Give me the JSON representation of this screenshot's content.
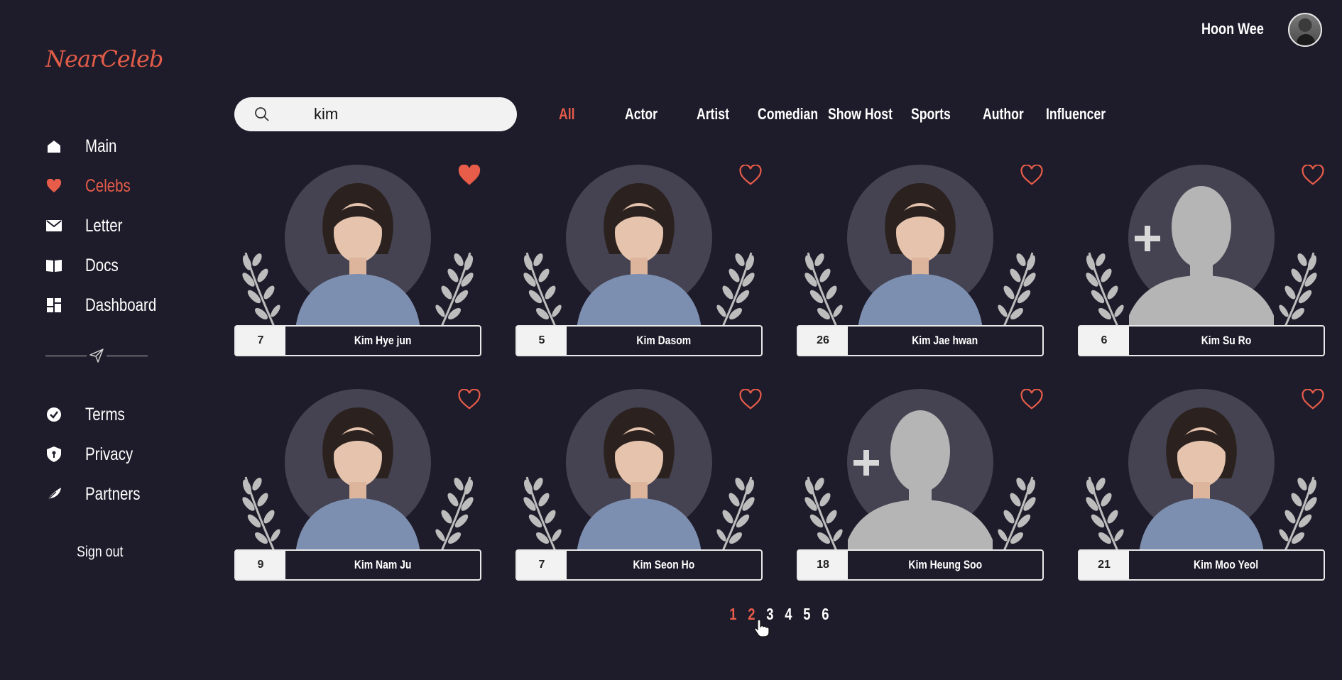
{
  "app": {
    "logo": "NearCeleb"
  },
  "header": {
    "user_name": "Hoon Wee"
  },
  "sidebar": {
    "items": [
      {
        "label": "Main",
        "icon": "home-icon"
      },
      {
        "label": "Celebs",
        "icon": "heart-icon",
        "active": true
      },
      {
        "label": "Letter",
        "icon": "mail-icon"
      },
      {
        "label": "Docs",
        "icon": "book-icon"
      },
      {
        "label": "Dashboard",
        "icon": "dashboard-icon"
      }
    ],
    "secondary_items": [
      {
        "label": "Terms",
        "icon": "check-circle-icon"
      },
      {
        "label": "Privacy",
        "icon": "shield-icon"
      },
      {
        "label": "Partners",
        "icon": "feather-icon"
      }
    ],
    "sign_out": "Sign out"
  },
  "search": {
    "value": "kim"
  },
  "tabs": [
    "All",
    "Actor",
    "Artist",
    "Comedian",
    "Show Host",
    "Sports",
    "Author",
    "Influencer"
  ],
  "active_tab": "All",
  "celebs": [
    {
      "count": "7",
      "name": "Kim Hye jun",
      "liked": true,
      "has_photo": true
    },
    {
      "count": "5",
      "name": "Kim Dasom",
      "liked": false,
      "has_photo": true
    },
    {
      "count": "26",
      "name": "Kim Jae hwan",
      "liked": false,
      "has_photo": true
    },
    {
      "count": "6",
      "name": "Kim Su Ro",
      "liked": false,
      "has_photo": false
    },
    {
      "count": "9",
      "name": "Kim Nam Ju",
      "liked": false,
      "has_photo": true
    },
    {
      "count": "7",
      "name": "Kim Seon Ho",
      "liked": false,
      "has_photo": true
    },
    {
      "count": "18",
      "name": "Kim Heung Soo",
      "liked": false,
      "has_photo": false
    },
    {
      "count": "21",
      "name": "Kim Moo Yeol",
      "liked": false,
      "has_photo": true
    }
  ],
  "pagination": {
    "pages": [
      "1",
      "2",
      "3",
      "4",
      "5",
      "6"
    ],
    "current": "1"
  },
  "colors": {
    "background": "#1e1c2a",
    "accent": "#e85c4a",
    "halo": "#454351",
    "laurel": "#bdbdbd"
  }
}
